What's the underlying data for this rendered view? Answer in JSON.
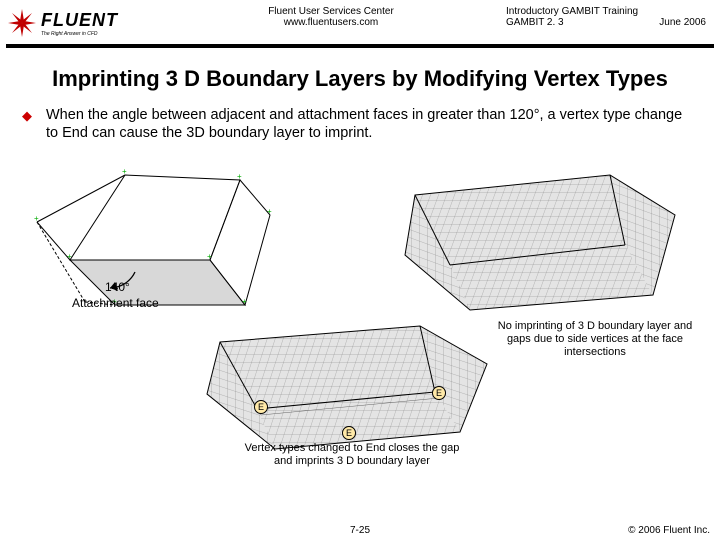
{
  "header": {
    "logo_word": "FLUENT",
    "logo_tagline": "The Right Answer in CFD",
    "center_line1": "Fluent User Services Center",
    "center_line2": "www.fluentusers.com",
    "right_line1": "Introductory GAMBIT Training",
    "right_line2a": "GAMBIT 2. 3",
    "right_line2b": "June 2006"
  },
  "title": "Imprinting 3 D Boundary Layers by Modifying Vertex Types",
  "bullet": "When the angle between adjacent and attachment faces in greater than 120°, a vertex type change to End can cause the 3D boundary layer to imprint.",
  "diagram": {
    "angle_label": "140°",
    "attachment_label": "Attachment face",
    "caption_right": "No imprinting of 3 D boundary layer and gaps due to side vertices at the face intersections",
    "caption_bottom": "Vertex types changed to End closes the gap and imprints 3 D boundary layer",
    "e_label": "E"
  },
  "footer": {
    "slide_number": "7-25",
    "copyright": "© 2006 Fluent Inc."
  },
  "colors": {
    "accent": "#c00000"
  }
}
